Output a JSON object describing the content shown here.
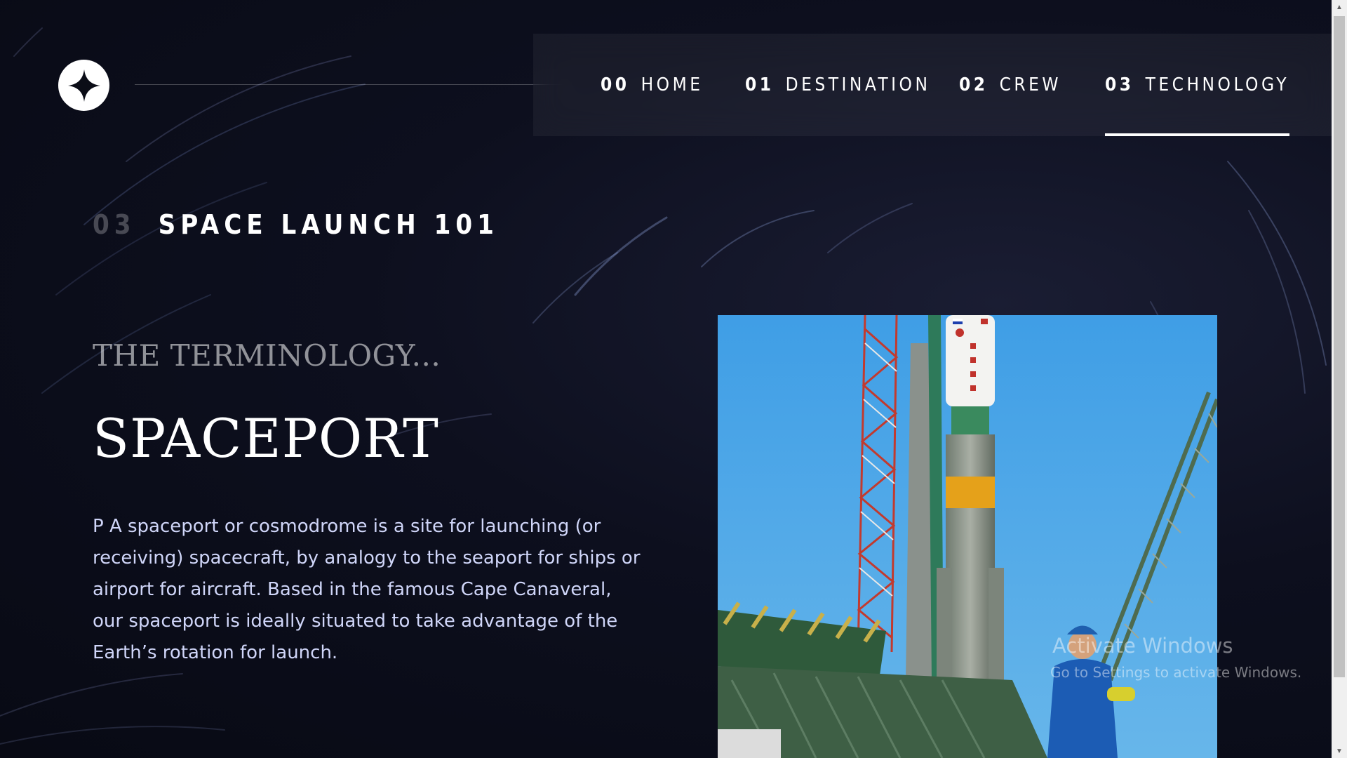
{
  "nav": {
    "items": [
      {
        "num": "00",
        "label": "HOME"
      },
      {
        "num": "01",
        "label": "DESTINATION"
      },
      {
        "num": "02",
        "label": "CREW"
      },
      {
        "num": "03",
        "label": "TECHNOLOGY"
      }
    ],
    "active_index": 3
  },
  "page_heading": {
    "num": "03",
    "label": "SPACE LAUNCH 101"
  },
  "content": {
    "subtitle": "THE TERMINOLOGY...",
    "title": "SPACEPORT",
    "body": "P A spaceport or cosmodrome is a site for launching (or receiving) spacecraft, by analogy to the seaport for ships or airport for aircraft. Based in the famous Cape Canaveral, our spaceport is ideally situated to take advantage of the Earth’s rotation for launch."
  },
  "watermark": {
    "title": "Activate Windows",
    "subtitle": "Go to Settings to activate Windows."
  },
  "colors": {
    "background": "#0b0d17",
    "accent_text": "#d0d6f9",
    "white": "#ffffff",
    "sky": "#4aa3e0"
  },
  "icons": {
    "logo": "four-point-star-icon",
    "scroll_up": "triangle-up-icon",
    "scroll_down": "triangle-down-icon"
  }
}
